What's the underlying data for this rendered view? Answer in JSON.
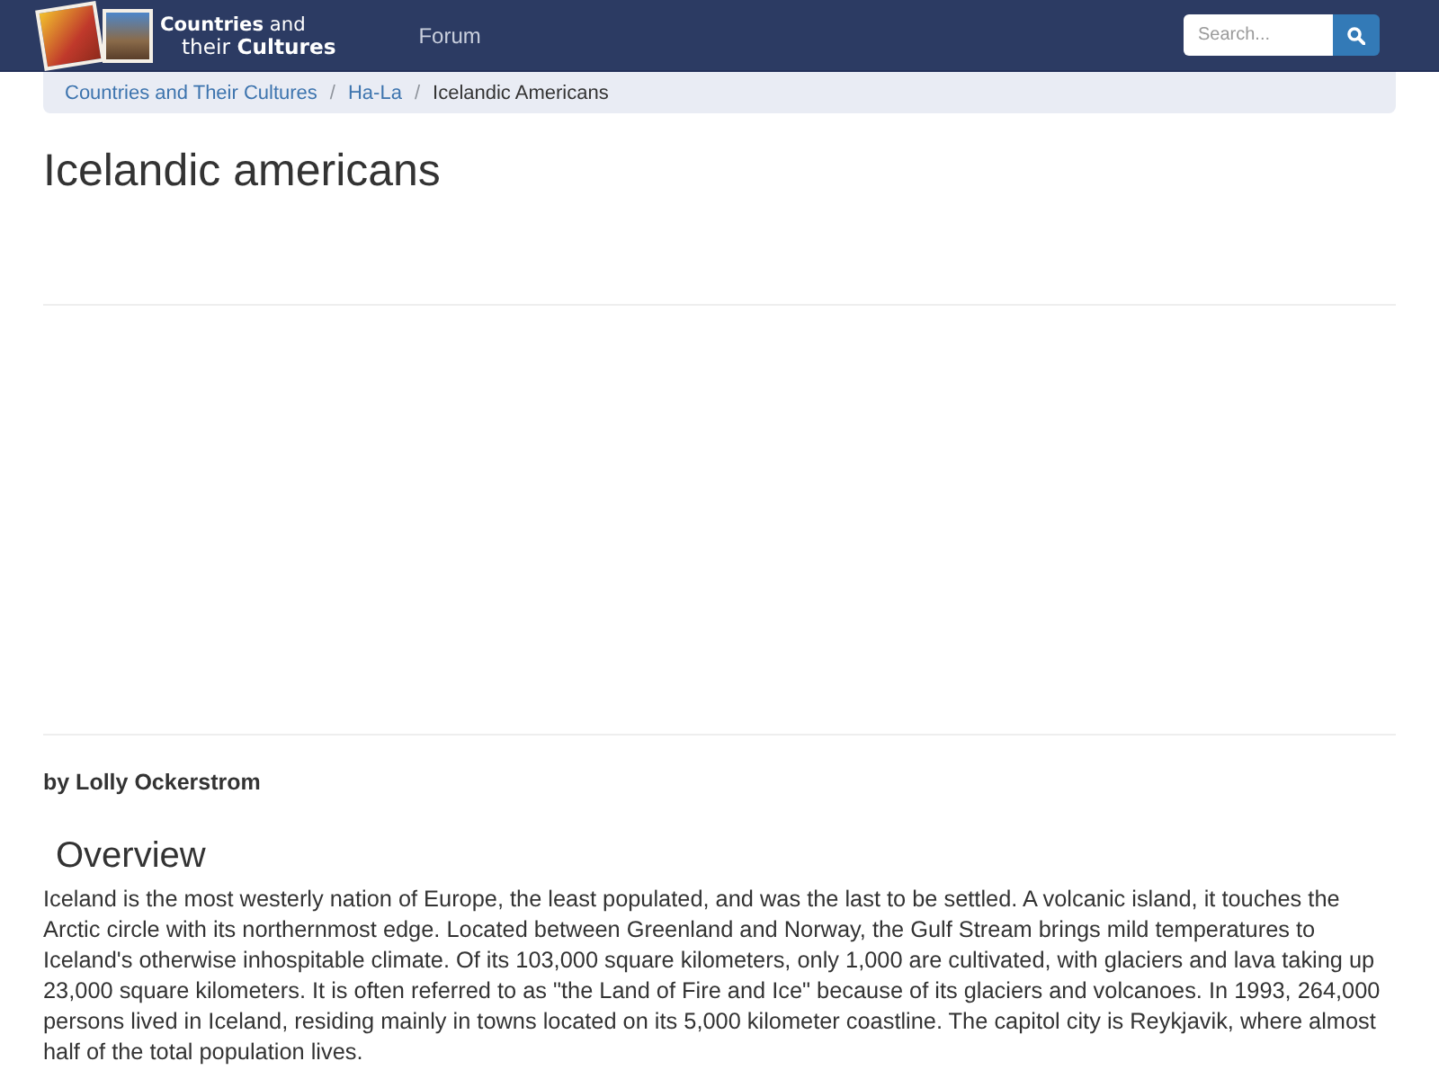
{
  "navbar": {
    "logo": {
      "lines": [
        "**Countries** and",
        "their **Cultures**"
      ]
    },
    "links": [
      {
        "label": "Forum"
      }
    ],
    "search": {
      "placeholder": "Search..."
    }
  },
  "breadcrumb": [
    {
      "kind": "link",
      "label": "Countries and Their Cultures"
    },
    {
      "kind": "link",
      "separator": "/",
      "label": "Ha-La"
    },
    {
      "kind": "current",
      "separator": "/",
      "label": "Icelandic Americans"
    }
  ],
  "article": {
    "title": "Icelandic americans",
    "byline": "by Lolly Ockerstrom",
    "sections": [
      {
        "heading": "Overview",
        "paragraphs": [
          "Iceland is the most westerly nation of Europe, the least populated, and was the last to be settled. A volcanic island, it touches the Arctic circle with its northernmost edge. Located between Greenland and Norway, the Gulf Stream brings mild temperatures to Iceland's otherwise inhospitable climate. Of its 103,000 square kilometers, only 1,000 are cultivated, with glaciers and lava taking up 23,000 square kilometers. It is often referred to as \"the Land of Fire and Ice\" because of its glaciers and volcanoes. In 1993, 264,000 persons lived in Iceland, residing mainly in towns located on its 5,000 kilometer coastline. The capitol city is Reykjavik, where almost half of the total population lives."
        ]
      }
    ]
  }
}
